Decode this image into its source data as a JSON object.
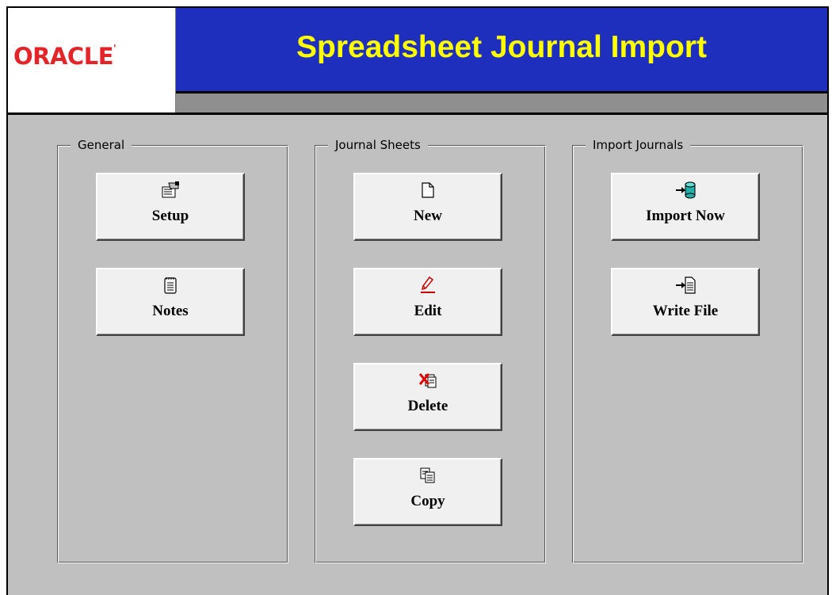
{
  "header": {
    "logo_text": "ORACLE",
    "logo_mark": "'",
    "title": "Spreadsheet Journal Import"
  },
  "groups": [
    {
      "label": "General",
      "buttons": [
        {
          "label": "Setup",
          "icon": "setup-icon"
        },
        {
          "label": "Notes",
          "icon": "notes-icon"
        }
      ]
    },
    {
      "label": "Journal Sheets",
      "buttons": [
        {
          "label": "New",
          "icon": "new-document-icon"
        },
        {
          "label": "Edit",
          "icon": "pencil-icon"
        },
        {
          "label": "Delete",
          "icon": "delete-icon"
        },
        {
          "label": "Copy",
          "icon": "copy-icon"
        }
      ]
    },
    {
      "label": "Import Journals",
      "buttons": [
        {
          "label": "Import Now",
          "icon": "import-database-icon"
        },
        {
          "label": "Write File",
          "icon": "write-file-icon"
        }
      ]
    }
  ],
  "colors": {
    "title_bar": "#1e2ebd",
    "title_text": "#ffff00",
    "logo_red": "#e52429",
    "background": "#c0c0c0",
    "button_face": "#f0f0f0"
  }
}
